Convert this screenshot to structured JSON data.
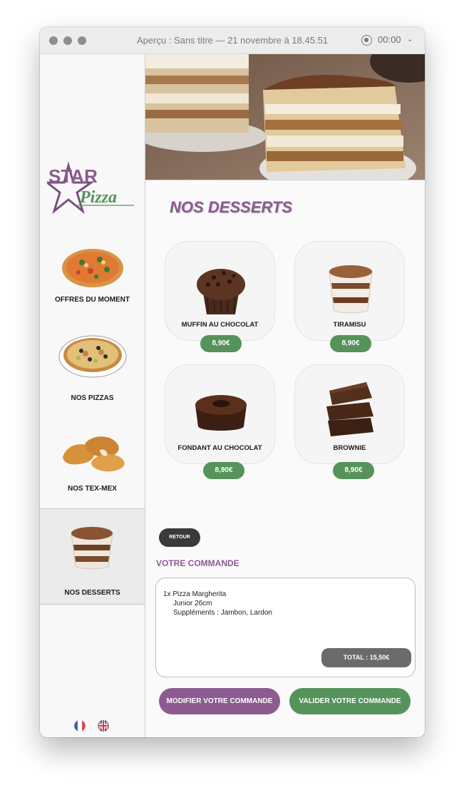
{
  "window": {
    "title": "Aperçu : Sans titre — 21 novembre à 18.45.51",
    "timer": "00:00"
  },
  "logo": {
    "text_star": "STAR",
    "text_pizza": "Pizza"
  },
  "sidebar": {
    "items": [
      {
        "label": "OFFRES DU MOMENT"
      },
      {
        "label": "NOS PIZZAS"
      },
      {
        "label": "NOS TEX-MEX"
      },
      {
        "label": "NOS DESSERTS"
      }
    ]
  },
  "main": {
    "heading": "NOS DESSERTS",
    "products": [
      {
        "name": "MUFFIN AU CHOCOLAT",
        "price": "8,90€"
      },
      {
        "name": "TIRAMISU",
        "price": "8,90€"
      },
      {
        "name": "FONDANT AU CHOCOLAT",
        "price": "8,90€"
      },
      {
        "name": "BROWNIE",
        "price": "8,90€"
      }
    ],
    "back_label": "RETOUR"
  },
  "order": {
    "title": "VOTRE COMMANDE",
    "line1": "1x Pizza Margherita",
    "line2": "Junior 26cm",
    "line3": "Suppléments : Jambon, Lardon",
    "total": "TOTAL : 15,50€",
    "modify_label": "MODIFIER VOTRE COMMANDE",
    "validate_label": "VALIDER VOTRE COMMANDE"
  },
  "colors": {
    "purple": "#8c5b91",
    "green": "#55935a",
    "dark": "#3a3a3a"
  }
}
